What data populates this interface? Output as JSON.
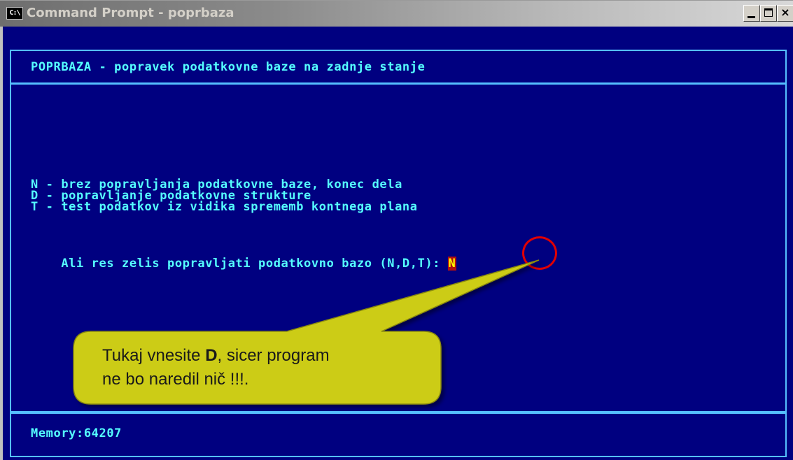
{
  "window": {
    "title": "Command Prompt - poprbaza",
    "icon_text": "C:\\",
    "controls": {
      "minimize": "minimize-icon",
      "maximize": "maximize-icon",
      "close": "close-icon",
      "close_glyph": "×"
    }
  },
  "console": {
    "header": "POPRBAZA - popravek podatkovne baze na zadnje stanje",
    "options": [
      "N - brez popravljanja podatkovne baze, konec dela",
      "D - popravljanje podatkovne strukture",
      "T - test podatkov iz vidika sprememb kontnega plana"
    ],
    "prompt": "Ali res zelis popravljati podatkovno bazo (N,D,T):",
    "input_value": "N",
    "status": "Memory:64207"
  },
  "callout": {
    "text_before": "Tukaj vnesite ",
    "text_bold": "D",
    "text_after": ", sicer program",
    "line2": "ne bo naredil nič !!!."
  },
  "colors": {
    "console_bg": "#000080",
    "console_text": "#55ffff",
    "callout_fill": "#cccc18",
    "highlight_ring": "#e00000"
  }
}
